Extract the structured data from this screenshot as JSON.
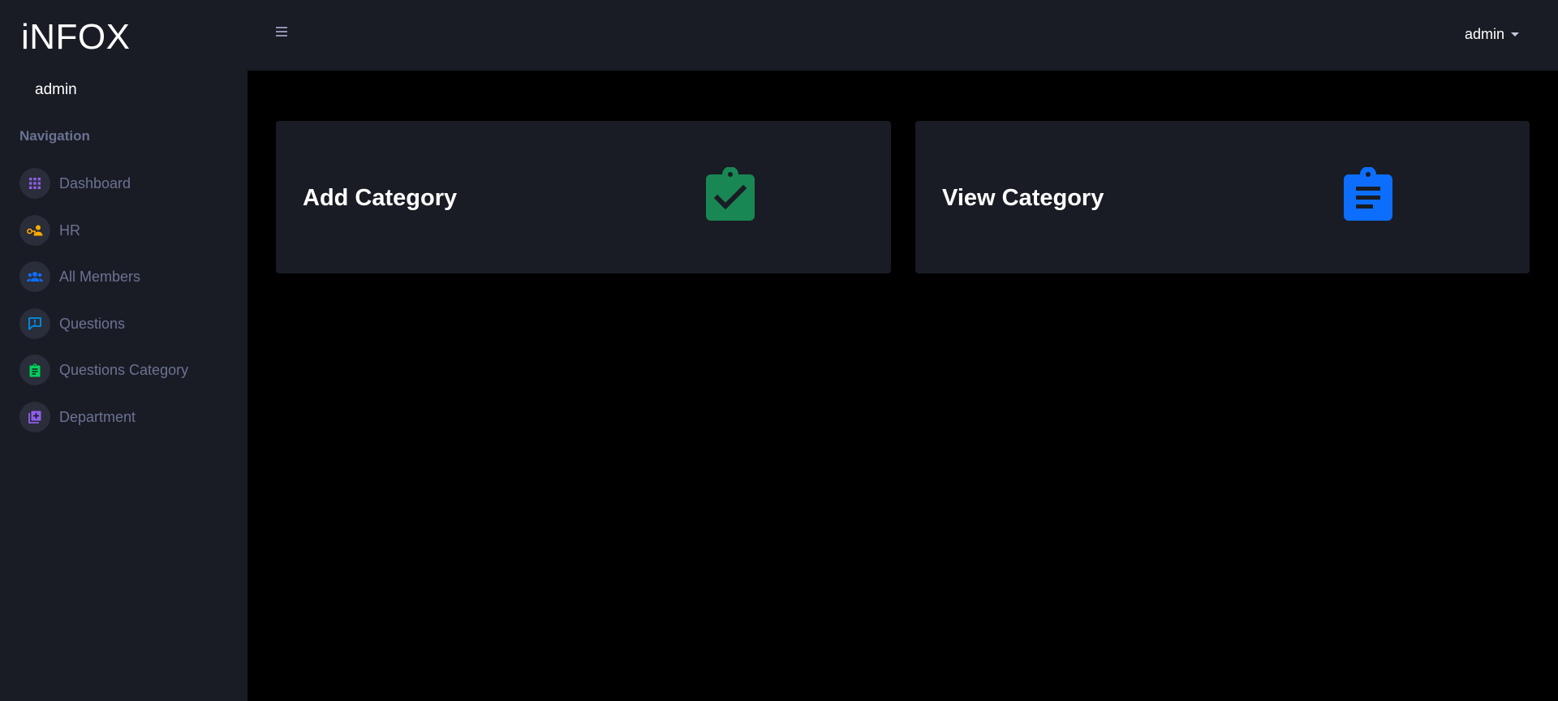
{
  "brand": "iNFOX",
  "sidebar": {
    "user": "admin",
    "nav_heading": "Navigation",
    "items": [
      {
        "label": "Dashboard",
        "icon": "grid-icon",
        "color": "#8f5fe8"
      },
      {
        "label": "HR",
        "icon": "user-key-icon",
        "color": "#ffab00"
      },
      {
        "label": "All Members",
        "icon": "users-icon",
        "color": "#0d6efd"
      },
      {
        "label": "Questions",
        "icon": "message-alert-icon",
        "color": "#0090e7"
      },
      {
        "label": "Questions Category",
        "icon": "clipboard-text-icon",
        "color": "#00d25b"
      },
      {
        "label": "Department",
        "icon": "library-plus-icon",
        "color": "#8f5fe8"
      }
    ]
  },
  "topbar": {
    "user": "admin"
  },
  "cards": {
    "add": {
      "label": "Add Category",
      "icon": "clipboard-check-icon",
      "color": "#198754"
    },
    "view": {
      "label": "View Category",
      "icon": "clipboard-text-icon",
      "color": "#0d6efd"
    }
  },
  "colors": {
    "sidebar_bg": "#191c24",
    "content_bg": "#000000",
    "muted_text": "#6c7293"
  }
}
